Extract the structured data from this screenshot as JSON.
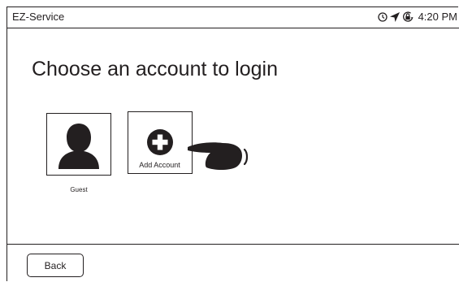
{
  "status_bar": {
    "app_name": "EZ-Service",
    "icons": [
      "clock-icon",
      "location-arrow-icon",
      "lock-rotation-icon"
    ],
    "time": "4:20 PM"
  },
  "main": {
    "title": "Choose an account to login",
    "accounts": [
      {
        "label": "Guest",
        "icon": "person-icon"
      },
      {
        "label": "Add Account",
        "icon": "plus-circle-icon"
      }
    ],
    "pointer_icon": "pointing-hand-icon"
  },
  "footer": {
    "back_label": "Back"
  }
}
